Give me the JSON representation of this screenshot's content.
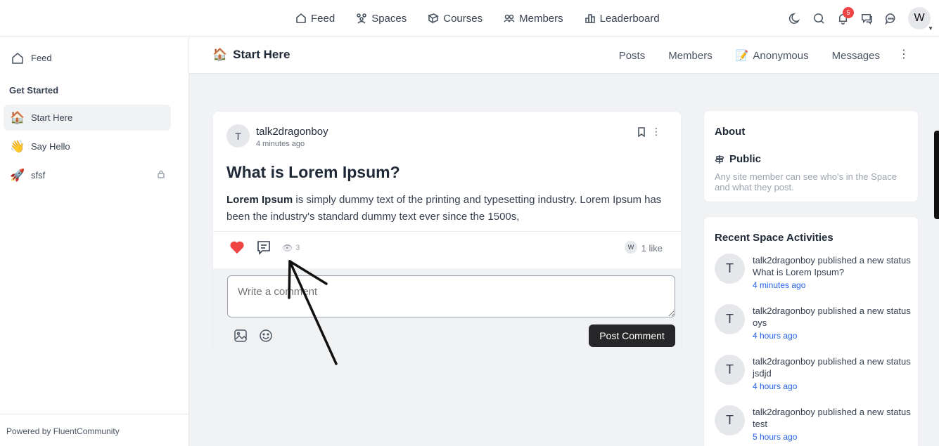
{
  "topnav": {
    "items": [
      {
        "label": "Feed",
        "icon": "home-icon"
      },
      {
        "label": "Spaces",
        "icon": "spaces-icon"
      },
      {
        "label": "Courses",
        "icon": "courses-icon"
      },
      {
        "label": "Members",
        "icon": "members-icon"
      },
      {
        "label": "Leaderboard",
        "icon": "leaderboard-icon"
      }
    ],
    "notification_count": "5",
    "user_initial": "W"
  },
  "sidebar": {
    "feed_label": "Feed",
    "section_heading": "Get Started",
    "items": [
      {
        "label": "Start Here",
        "emoji": "🏠"
      },
      {
        "label": "Say Hello",
        "emoji": "👋"
      },
      {
        "label": "sfsf",
        "emoji": "🚀"
      }
    ],
    "powered_by": "Powered by FluentCommunity"
  },
  "space": {
    "emoji": "🏠",
    "title": "Start Here",
    "tabs": {
      "posts": "Posts",
      "members": "Members",
      "anonymous": "Anonymous",
      "anonymous_emoji": "📝",
      "messages": "Messages"
    }
  },
  "post": {
    "author_initial": "T",
    "author": "talk2dragonboy",
    "time": "4 minutes ago",
    "title": "What is Lorem Ipsum?",
    "body_bold": "Lorem Ipsum",
    "body_rest": " is simply dummy text of the printing and typesetting industry. Lorem Ipsum has been the industry's standard dummy text ever since the 1500s,",
    "view_count": "3",
    "liker_initial": "W",
    "likes": "1 like",
    "comment_placeholder": "Write a comment",
    "post_comment_label": "Post Comment"
  },
  "about": {
    "title": "About",
    "privacy": "Public",
    "description": "Any site member can see who's in the Space and what they post."
  },
  "activities": {
    "title": "Recent Space Activities",
    "items": [
      {
        "initial": "T",
        "text": "talk2dragonboy published a new status What is Lorem Ipsum?",
        "time": "4 minutes ago"
      },
      {
        "initial": "T",
        "text": "talk2dragonboy published a new status oys",
        "time": "4 hours ago"
      },
      {
        "initial": "T",
        "text": "talk2dragonboy published a new status jsdjd",
        "time": "4 hours ago"
      },
      {
        "initial": "T",
        "text": "talk2dragonboy published a new status test",
        "time": "5 hours ago"
      }
    ]
  },
  "colors": {
    "heart": "#ef4444",
    "link": "#2563eb",
    "button": "#27272a",
    "badge": "#ef4444"
  }
}
